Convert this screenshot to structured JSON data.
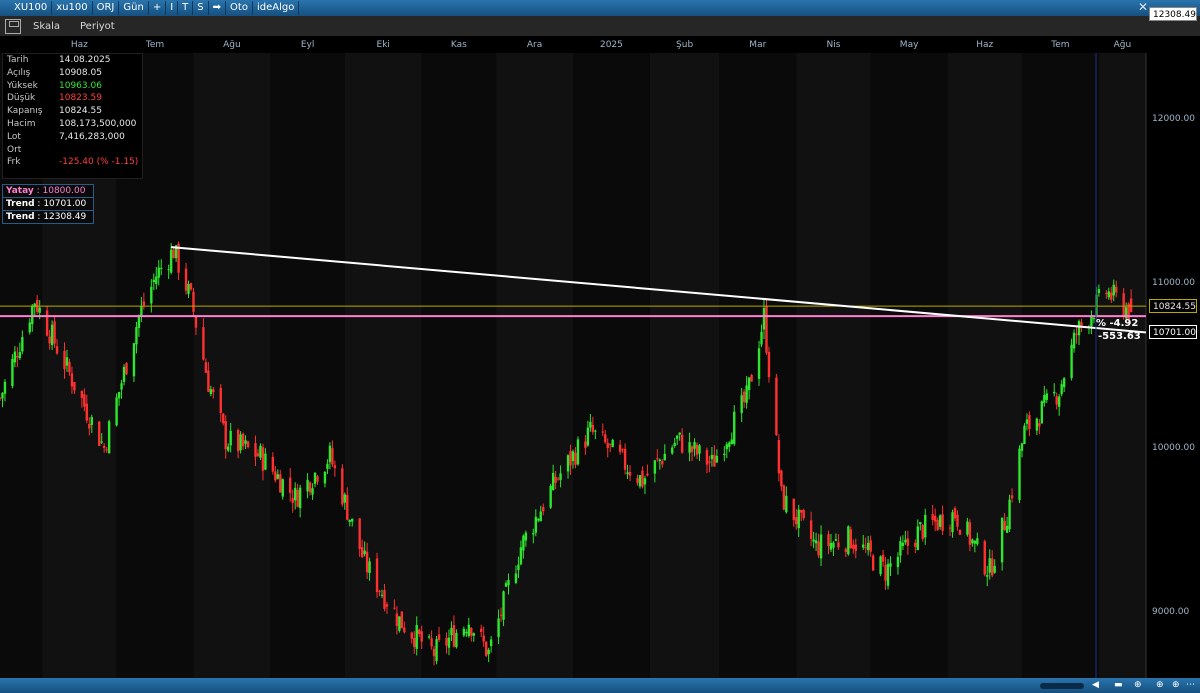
{
  "titlebar": {
    "items": [
      {
        "label": "XU100",
        "name": "symbol-label"
      },
      {
        "label": "xu100",
        "name": "symbol-input"
      },
      {
        "label": "ORJ",
        "name": "orj-button"
      },
      {
        "label": "Gün",
        "name": "period-button"
      },
      {
        "label": "+",
        "name": "add-button"
      },
      {
        "label": "I",
        "name": "indicator-button"
      },
      {
        "label": "T",
        "name": "t-button"
      },
      {
        "label": "S",
        "name": "s-button"
      },
      {
        "label": "➡",
        "name": "arrow-button"
      },
      {
        "label": "Oto",
        "name": "auto-button"
      },
      {
        "label": "ideAlgo",
        "name": "idealgo-button"
      }
    ],
    "close_icon": "close-icon"
  },
  "toolbar": {
    "save_icon": "save-icon",
    "scale_label": "Skala",
    "period_label": "Periyot"
  },
  "months": [
    "Haz",
    "Tem",
    "Ağu",
    "Eyl",
    "Eki",
    "Kas",
    "Ara",
    "2025",
    "Şub",
    "Mar",
    "Nis",
    "May",
    "Haz",
    "Tem",
    "Ağu"
  ],
  "info": [
    {
      "label": "Tarih",
      "value": "14.08.2025",
      "color": "#e8e8e8"
    },
    {
      "label": "Açılış",
      "value": "10908.05",
      "color": "#e8e8e8"
    },
    {
      "label": "Yüksek",
      "value": "10963.06",
      "color": "#35e635"
    },
    {
      "label": "Düşük",
      "value": "10823.59",
      "color": "#ff4040"
    },
    {
      "label": "Kapanış",
      "value": "10824.55",
      "color": "#e8e8e8"
    },
    {
      "label": "Hacim",
      "value": "108,173,500,000",
      "color": "#e8e8e8"
    },
    {
      "label": "Lot",
      "value": "7,416,283,000",
      "color": "#e8e8e8"
    },
    {
      "label": "Ort",
      "value": "",
      "color": "#e8e8e8"
    },
    {
      "label": "Frk",
      "value": "-125.40 (% -1.15)",
      "color": "#ff4040"
    }
  ],
  "legend": [
    {
      "label": "Yatay",
      "value": "10800.00",
      "color": "#ff7fd0"
    },
    {
      "label": "Trend",
      "value": "10701.00",
      "color": "#ffffff"
    },
    {
      "label": "Trend",
      "value": "12308.49",
      "color": "#ffffff"
    }
  ],
  "price_badges": {
    "top": "12308.49",
    "close": "10824.55",
    "trend": "10701.00"
  },
  "trend_annotation": {
    "percent": "% -4.92",
    "points": "-553.63"
  },
  "colors": {
    "up": "#2ee62e",
    "down": "#ff3030",
    "horizontal": "#ff7fd0",
    "trendline": "#ffffff",
    "close_line": "#b8a800",
    "cursor": "#1e2f8f"
  },
  "chart_data": {
    "type": "candlestick",
    "instrument": "XU100",
    "period": "daily",
    "x_range": [
      "2024-05-15",
      "2025-08-20"
    ],
    "ylim": [
      8600,
      12400
    ],
    "y_ticks": [
      "12000.00",
      "11000.00",
      "10000.00",
      "9000.00"
    ],
    "close_path": [
      [
        "2024-05-15",
        10300
      ],
      [
        "2024-05-29",
        10900
      ],
      [
        "2024-06-12",
        10450
      ],
      [
        "2024-06-26",
        10000
      ],
      [
        "2024-07-10",
        10800
      ],
      [
        "2024-07-17",
        11050
      ],
      [
        "2024-07-24",
        11200
      ],
      [
        "2024-07-31",
        10900
      ],
      [
        "2024-08-07",
        10400
      ],
      [
        "2024-08-14",
        10050
      ],
      [
        "2024-08-28",
        9950
      ],
      [
        "2024-09-11",
        9700
      ],
      [
        "2024-09-25",
        9950
      ],
      [
        "2024-10-09",
        9300
      ],
      [
        "2024-10-23",
        8950
      ],
      [
        "2024-11-06",
        8750
      ],
      [
        "2024-11-20",
        8950
      ],
      [
        "2024-11-28",
        8750
      ],
      [
        "2024-12-11",
        9400
      ],
      [
        "2024-12-25",
        9800
      ],
      [
        "2025-01-08",
        10100
      ],
      [
        "2025-01-15",
        10000
      ],
      [
        "2025-01-29",
        9800
      ],
      [
        "2025-02-12",
        10050
      ],
      [
        "2025-02-26",
        9900
      ],
      [
        "2025-03-12",
        10300
      ],
      [
        "2025-03-19",
        10800
      ],
      [
        "2025-03-26",
        9700
      ],
      [
        "2025-04-09",
        9400
      ],
      [
        "2025-04-23",
        9450
      ],
      [
        "2025-05-07",
        9250
      ],
      [
        "2025-05-21",
        9500
      ],
      [
        "2025-06-04",
        9600
      ],
      [
        "2025-06-18",
        9250
      ],
      [
        "2025-06-25",
        9600
      ],
      [
        "2025-07-02",
        10100
      ],
      [
        "2025-07-16",
        10350
      ],
      [
        "2025-07-23",
        10700
      ],
      [
        "2025-08-04",
        10950
      ],
      [
        "2025-08-14",
        10824.55
      ]
    ],
    "horizontal_line": {
      "name": "Yatay",
      "value": 10800.0
    },
    "trendline": {
      "start": [
        "2024-07-23",
        11220
      ],
      "end": [
        "2025-08-20",
        10701.0
      ],
      "change_percent": -4.92,
      "change_points": -553.63
    },
    "last_candle": {
      "date": "2025-08-14",
      "open": 10908.05,
      "high": 10963.06,
      "low": 10823.59,
      "close": 10824.55,
      "volume": 108173500000,
      "lot": 7416283000,
      "change": -125.4,
      "change_percent": -1.15
    }
  }
}
